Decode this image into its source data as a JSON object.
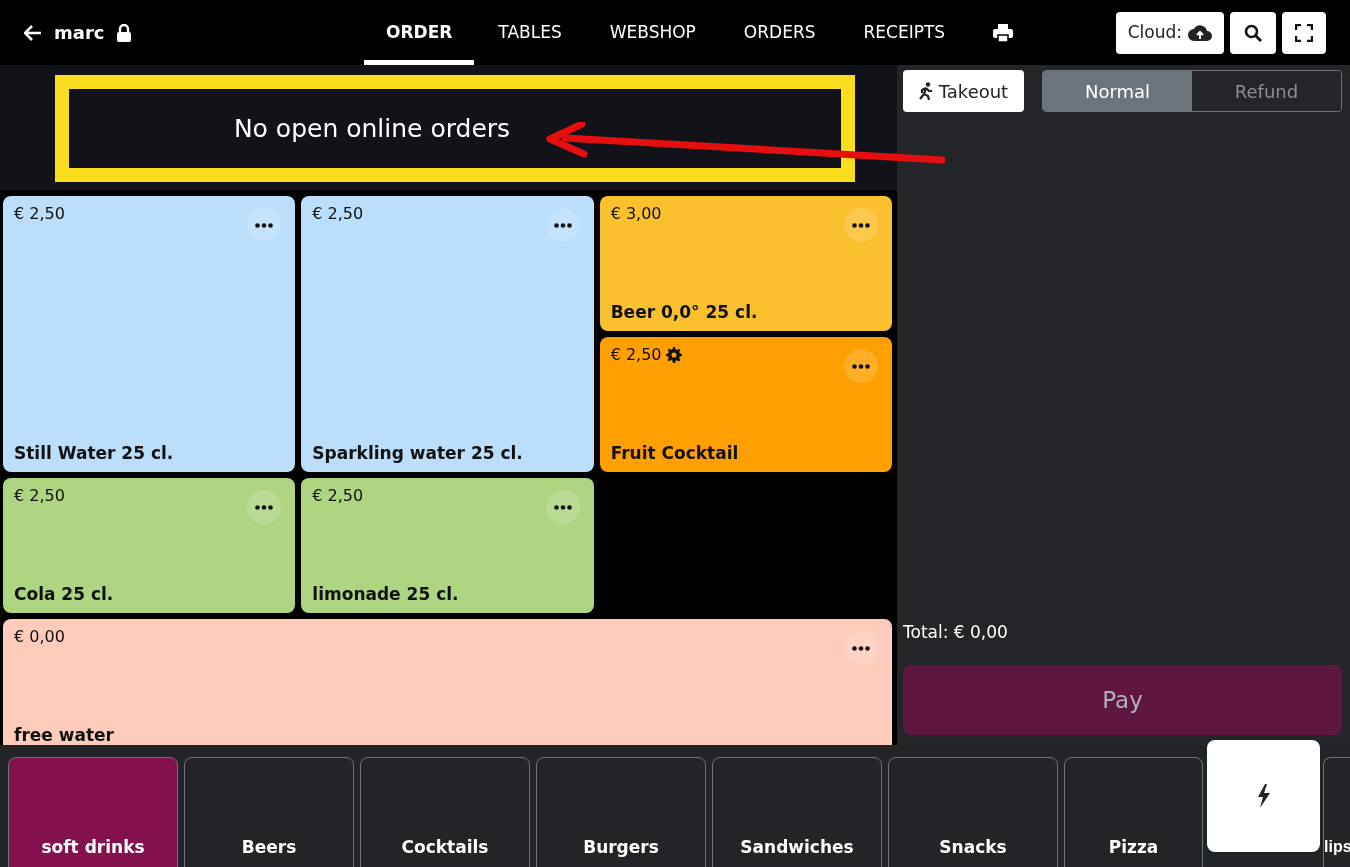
{
  "header": {
    "user": "marc",
    "tabs": [
      {
        "label": "ORDER",
        "selected": true
      },
      {
        "label": "TABLES",
        "selected": false
      },
      {
        "label": "WEBSHOP",
        "selected": false
      },
      {
        "label": "ORDERS",
        "selected": false
      },
      {
        "label": "RECEIPTS",
        "selected": false
      }
    ],
    "cloud_button": "Cloud:"
  },
  "banner": {
    "message": "No open online orders"
  },
  "products": [
    {
      "kind": "tall",
      "price": "€ 2,50",
      "name": "Still Water 25 cl.",
      "color": "#bbdefb",
      "gear": false
    },
    {
      "kind": "tall",
      "price": "€ 2,50",
      "name": "Sparkling water 25 cl.",
      "color": "#bbdefb",
      "gear": false
    },
    {
      "kind": "normal",
      "price": "€ 3,00",
      "name": "Beer 0,0° 25 cl.",
      "color": "#fbc02d",
      "gear": false
    },
    {
      "kind": "normal",
      "price": "€ 2,50",
      "name": "Fruit Cocktail",
      "color": "#ffa000",
      "gear": true
    },
    {
      "kind": "normal",
      "price": "€ 2,50",
      "name": "Cola 25 cl.",
      "color": "#aed581",
      "gear": false
    },
    {
      "kind": "normal",
      "price": "€ 2,50",
      "name": "limonade 25 cl.",
      "color": "#aed581",
      "gear": false
    },
    {
      "kind": "wide",
      "price": "€ 0,00",
      "name": "free water",
      "color": "#ffccbc",
      "gear": false
    }
  ],
  "categories": [
    {
      "label": "soft drinks",
      "selected": true
    },
    {
      "label": "Beers",
      "selected": false
    },
    {
      "label": "Cocktails",
      "selected": false
    },
    {
      "label": "Burgers",
      "selected": false
    },
    {
      "label": "Sandwiches",
      "selected": false
    },
    {
      "label": "Snacks",
      "selected": false
    },
    {
      "label": "Pizza",
      "selected": false
    },
    {
      "label": "lips",
      "selected": false
    }
  ],
  "order_panel": {
    "takeout_button": "Takeout",
    "modes": [
      {
        "label": "Normal",
        "selected": true
      },
      {
        "label": "Refund",
        "selected": false
      }
    ],
    "total": "Total: € 0,00",
    "pay_button": "Pay"
  }
}
